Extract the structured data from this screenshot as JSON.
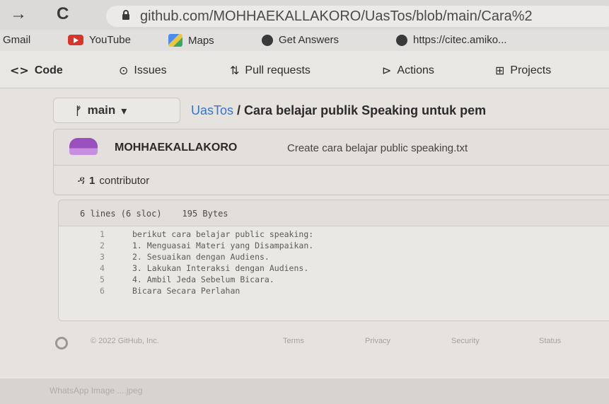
{
  "browser": {
    "url": "github.com/MOHHAEKALLAKORO/UasTos/blob/main/Cara%2"
  },
  "bookmarks": [
    {
      "label": "Gmail",
      "icon": "gmail"
    },
    {
      "label": "YouTube",
      "icon": "youtube-icon"
    },
    {
      "label": "Maps",
      "icon": "maps-icon"
    },
    {
      "label": "Get Answers",
      "icon": "globe-icon"
    },
    {
      "label": "https://citec.amiko...",
      "icon": "globe-icon"
    }
  ],
  "repo_nav": {
    "tabs": [
      {
        "label": "Code",
        "icon": "code-icon"
      },
      {
        "label": "Issues",
        "icon": "issue-icon"
      },
      {
        "label": "Pull requests",
        "icon": "pull-request-icon"
      },
      {
        "label": "Actions",
        "icon": "play-icon"
      },
      {
        "label": "Projects",
        "icon": "table-icon"
      }
    ]
  },
  "branch": {
    "label": "main"
  },
  "path": {
    "repo": "UasTos",
    "separator": " / ",
    "file": "Cara belajar publik Speaking untuk pem"
  },
  "commit": {
    "user": "MOHHAEKALLAKORO",
    "message": "Create cara belajar public speaking.txt"
  },
  "contributors": {
    "count": "1",
    "label": "contributor"
  },
  "file": {
    "lines_info": "6 lines (6 sloc)",
    "size": "195 Bytes",
    "lines": [
      {
        "n": "1",
        "text": "berikut cara belajar public speaking:"
      },
      {
        "n": "2",
        "text": "1. Menguasai Materi yang Disampaikan."
      },
      {
        "n": "3",
        "text": "2. Sesuaikan dengan Audiens."
      },
      {
        "n": "4",
        "text": "3. Lakukan Interaksi dengan Audiens."
      },
      {
        "n": "5",
        "text": "4. Ambil Jeda Sebelum Bicara."
      },
      {
        "n": "6",
        "text": "Bicara Secara Perlahan"
      }
    ]
  },
  "footer": {
    "copyright": "© 2022 GitHub, Inc.",
    "links": [
      "Terms",
      "Privacy",
      "Security",
      "Status"
    ]
  },
  "taskbar": {
    "download": "WhatsApp Image ....jpeg"
  }
}
